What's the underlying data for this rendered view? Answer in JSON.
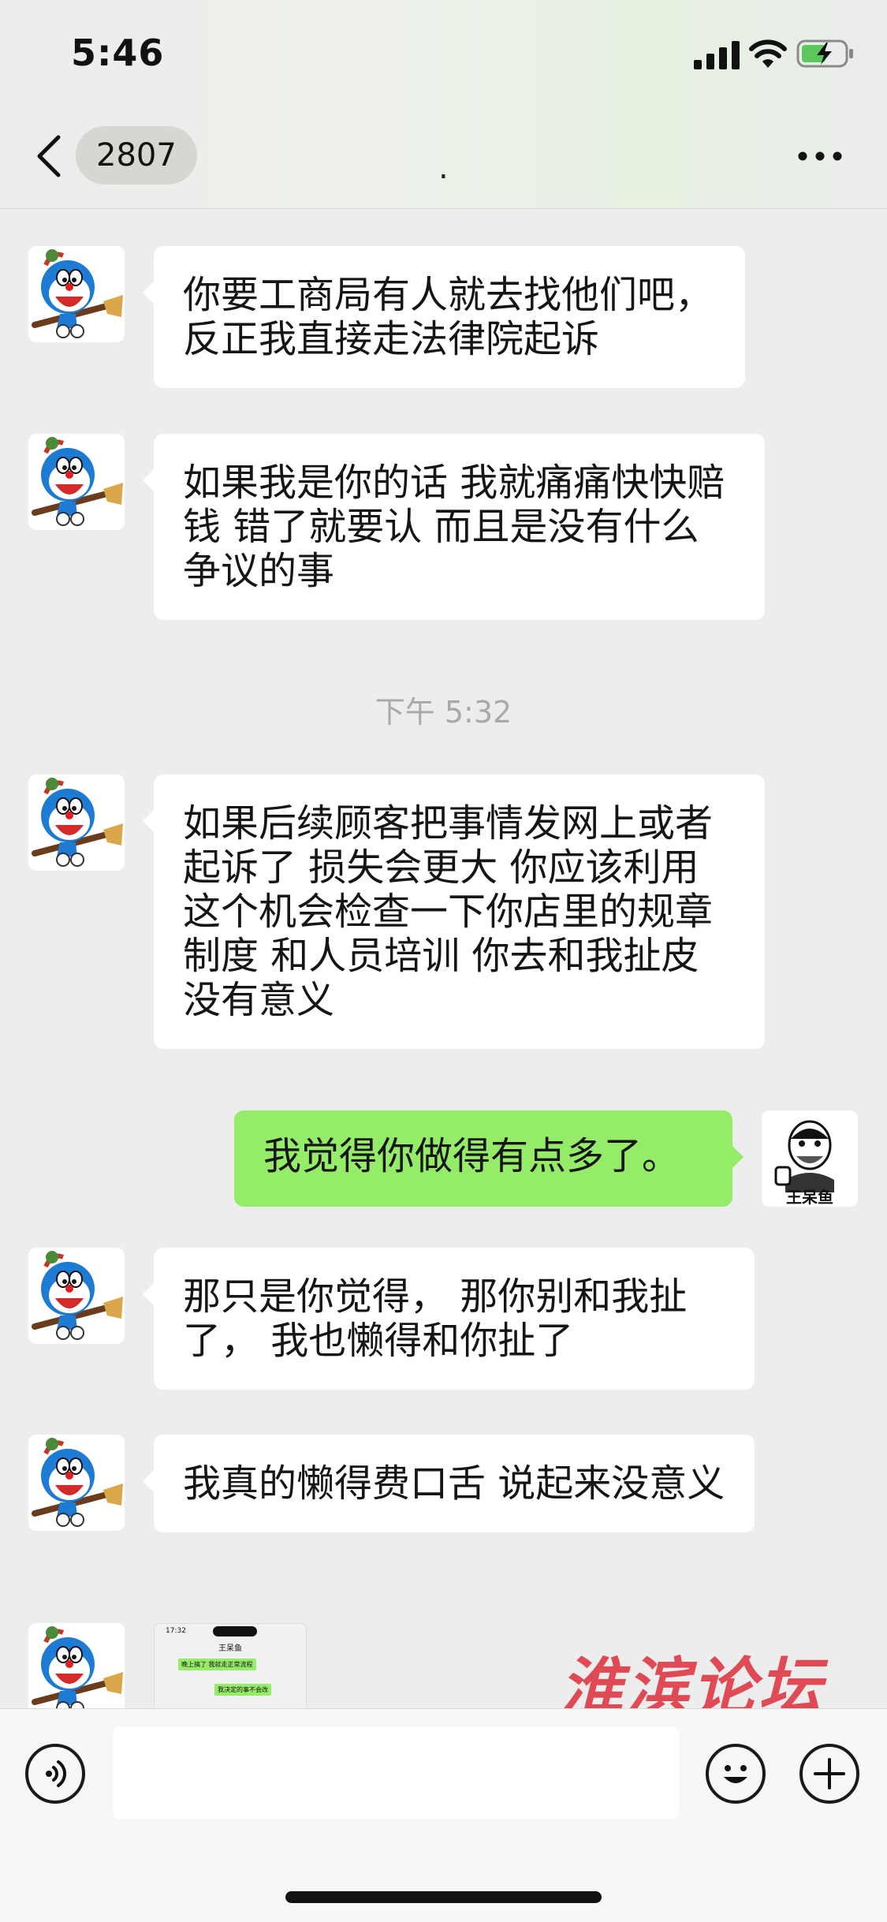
{
  "status_bar": {
    "time": "5:46"
  },
  "nav": {
    "unread_count": "2807",
    "title": "."
  },
  "messages": [
    {
      "text": "你要工商局有人就去找他们吧，反正我直接走法律院起诉"
    },
    {
      "text": "如果我是你的话 我就痛痛快快赔钱 错了就要认 而且是没有什么争议的事"
    },
    {
      "text": "如果后续顾客把事情发网上或者起诉了 损失会更大 你应该利用这个机会检查一下你店里的规章制度 和人员培训 你去和我扯皮没有意义"
    },
    {
      "text": "我觉得你做得有点多了。"
    },
    {
      "text": "那只是你觉得， 那你别和我扯了， 我也懒得和你扯了"
    },
    {
      "text": "我真的懒得费口舌 说起来没意义"
    }
  ],
  "timestamp": "下午 5:32",
  "my_avatar_label": "王呆鱼",
  "screenshot_thumbnail": {
    "time": "17:32",
    "title": "王呆鱼",
    "lines": [
      "晚上搞了 我就走正常流程",
      "我决定的事不会改"
    ]
  },
  "watermark": "淮滨论坛",
  "colors": {
    "my_bubble": "#95ec69",
    "watermark": "#e04a55"
  }
}
